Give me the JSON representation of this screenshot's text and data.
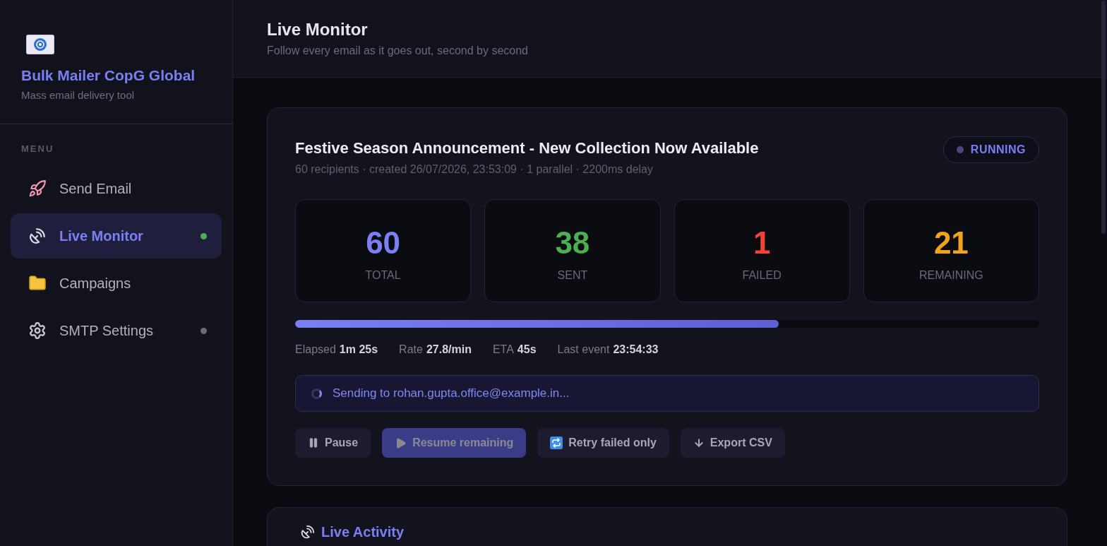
{
  "sidebar": {
    "brand": {
      "title": "Bulk Mailer CopG Global",
      "subtitle": "Mass email delivery tool"
    },
    "section_label": "MENU",
    "items": [
      {
        "label": "Send Email",
        "selected": false
      },
      {
        "label": "Live Monitor",
        "selected": true,
        "color": "#4caf50"
      },
      {
        "label": "Campaigns",
        "selected": false
      },
      {
        "label": "SMTP Settings",
        "selected": false,
        "color": "#6b6b75"
      }
    ]
  },
  "header": {
    "title": "Live Monitor",
    "subtitle": "Follow every email as it goes out, second by second"
  },
  "campaign": {
    "title": "Festive Season Announcement - New Collection Now Available",
    "meta": "60 recipients · created 26/07/2026, 23:53:09 · 1 parallel · 2200ms delay",
    "status": "RUNNING",
    "stats": [
      {
        "value": "60",
        "label": "TOTAL",
        "color": "#7b7ff5"
      },
      {
        "value": "38",
        "label": "SENT",
        "color": "#4caf50"
      },
      {
        "value": "1",
        "label": "FAILED",
        "color": "#f44336"
      },
      {
        "value": "21",
        "label": "REMAINING",
        "color": "#f0a31c"
      }
    ],
    "progress": {
      "level": 0.65
    },
    "metrics": [
      {
        "label": "Elapsed",
        "value": "1m 25s"
      },
      {
        "label": "Rate",
        "value": "27.8/min"
      },
      {
        "label": "ETA",
        "value": "45s"
      },
      {
        "label": "Last event",
        "value": "23:54:33"
      }
    ],
    "activity": "Sending to rohan.gupta.office@example.in...",
    "buttons": [
      {
        "label": "Pause",
        "kind": "pause",
        "disabled": false
      },
      {
        "label": "Resume remaining",
        "kind": "resume",
        "disabled": true
      },
      {
        "label": "Retry failed only",
        "kind": "retry",
        "disabled": false
      },
      {
        "label": "Export CSV",
        "kind": "export",
        "disabled": false
      }
    ]
  },
  "activity_panel": {
    "title": "Live Activity"
  }
}
